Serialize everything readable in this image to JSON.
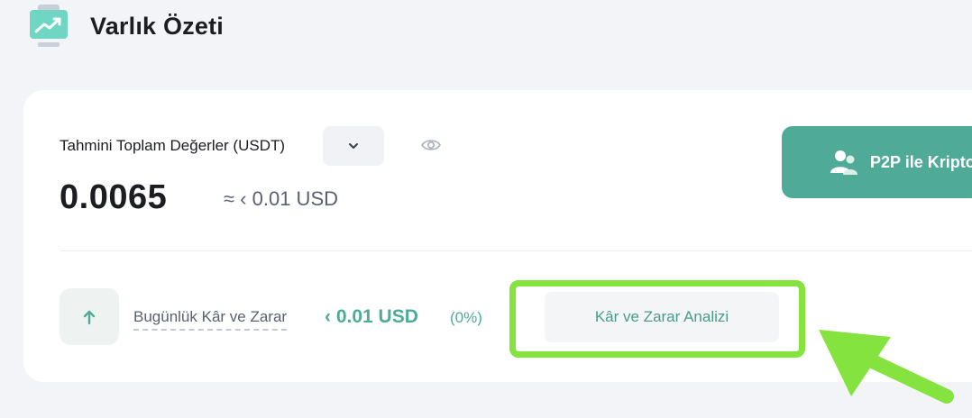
{
  "header": {
    "title": "Varlık Özeti",
    "icon": "trend-monitor-icon"
  },
  "summary": {
    "total_label": "Tahmini Toplam Değerler (USDT)",
    "total_value": "0.0065",
    "approx_value": "≈ ‹ 0.01 USD",
    "dropdown_icon": "chevron-down-icon",
    "visibility_icon": "eye-icon",
    "p2p_button_label": "P2P ile Kripto",
    "p2p_icon": "users-icon"
  },
  "daily": {
    "arrow_icon": "arrow-up-icon",
    "label": "Bugünlük Kâr ve Zarar",
    "value": "‹ 0.01 USD",
    "percent": "(0%)",
    "analysis_button_label": "Kâr ve Zarar Analizi"
  },
  "annotation": {
    "highlight_color": "#84e33f"
  },
  "colors": {
    "accent": "#4fab98",
    "background": "#f3f4f8",
    "card": "#ffffff"
  }
}
